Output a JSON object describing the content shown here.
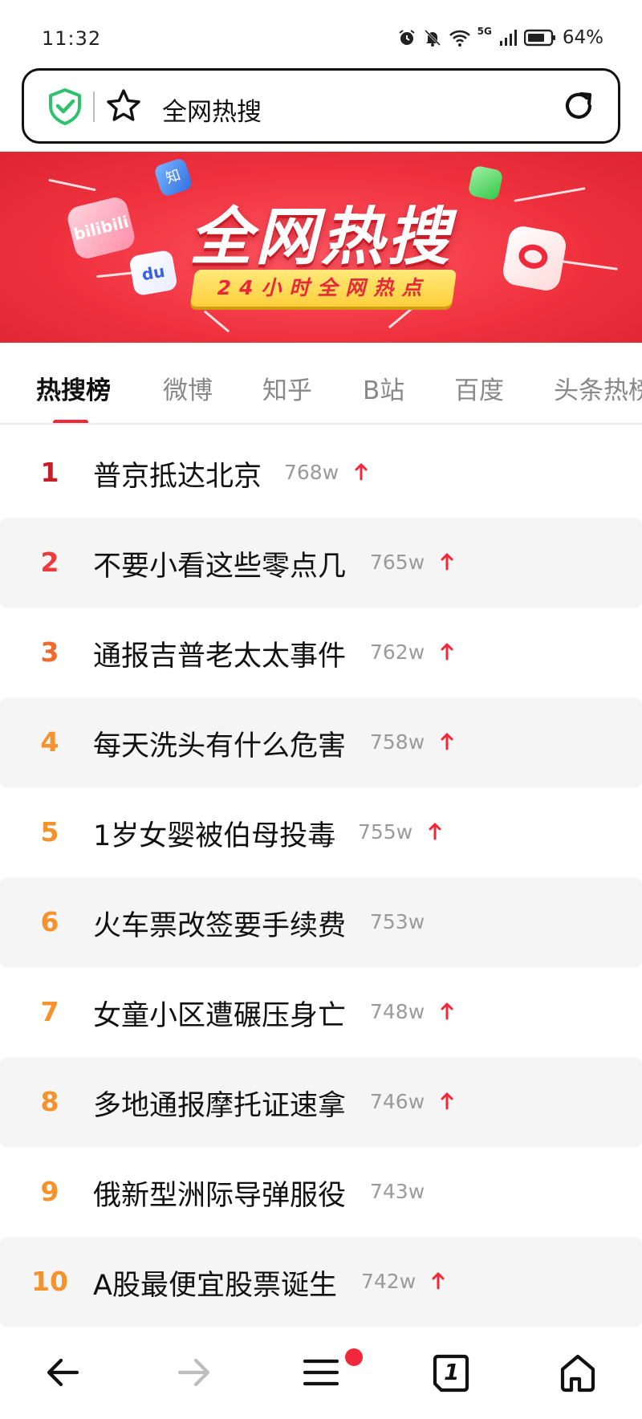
{
  "status_bar": {
    "time": "11:32",
    "network": "5G",
    "battery": "64%",
    "icons": [
      "alarm-icon",
      "mute-icon",
      "wifi-icon",
      "signal-icon",
      "battery-icon"
    ]
  },
  "address_bar": {
    "text": "全网热搜",
    "icons": [
      "shield-icon",
      "star-icon",
      "refresh-icon"
    ]
  },
  "banner": {
    "title": "全网热搜",
    "subtitle": "24小时全网热点",
    "logo_texts": {
      "bilibili": "bilibili",
      "zhihu": "知",
      "baidu": "du"
    }
  },
  "tabs": [
    {
      "label": "热搜榜",
      "active": true
    },
    {
      "label": "微博",
      "active": false
    },
    {
      "label": "知乎",
      "active": false
    },
    {
      "label": "B站",
      "active": false
    },
    {
      "label": "百度",
      "active": false
    },
    {
      "label": "头条热榜",
      "active": false
    }
  ],
  "hot_list": [
    {
      "rank": "1",
      "title": "普京抵达北京",
      "count": "768w",
      "rising": true
    },
    {
      "rank": "2",
      "title": "不要小看这些零点几",
      "count": "765w",
      "rising": true
    },
    {
      "rank": "3",
      "title": "通报吉普老太太事件",
      "count": "762w",
      "rising": true
    },
    {
      "rank": "4",
      "title": "每天洗头有什么危害",
      "count": "758w",
      "rising": true
    },
    {
      "rank": "5",
      "title": "1岁女婴被伯母投毒",
      "count": "755w",
      "rising": true
    },
    {
      "rank": "6",
      "title": "火车票改签要手续费",
      "count": "753w",
      "rising": false
    },
    {
      "rank": "7",
      "title": "女童小区遭碾压身亡",
      "count": "748w",
      "rising": true
    },
    {
      "rank": "8",
      "title": "多地通报摩托证速拿",
      "count": "746w",
      "rising": true
    },
    {
      "rank": "9",
      "title": "俄新型洲际导弹服役",
      "count": "743w",
      "rising": false
    },
    {
      "rank": "10",
      "title": "A股最便宜股票诞生",
      "count": "742w",
      "rising": true
    }
  ],
  "colors": {
    "accent": "#f0283a",
    "rank_1": "#c41e26",
    "rank_2": "#ea3a3a",
    "rank_3": "#ef6a2c",
    "rank_other": "#f5922b",
    "count": "#9a9a9a"
  },
  "bottom_nav": {
    "items": [
      "back-icon",
      "forward-icon",
      "menu-icon",
      "tabs-icon",
      "home-icon"
    ],
    "tab_count": "1"
  }
}
